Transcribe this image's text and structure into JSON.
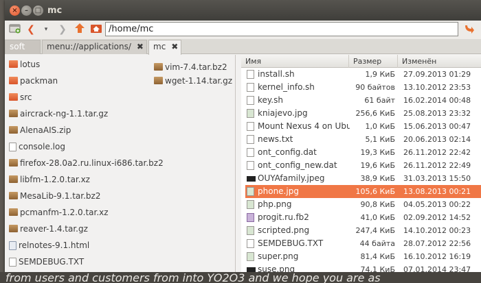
{
  "window": {
    "title": "mc"
  },
  "toolbar": {
    "path": "/home/mc"
  },
  "tabs": [
    {
      "label": "soft"
    },
    {
      "label": "menu://applications/"
    },
    {
      "label": "mc"
    }
  ],
  "left_pane": {
    "items": [
      {
        "name": "lotus",
        "kind": "folder"
      },
      {
        "name": "packman",
        "kind": "folder"
      },
      {
        "name": "src",
        "kind": "folder"
      },
      {
        "name": "aircrack-ng-1.1.tar.gz",
        "kind": "archive"
      },
      {
        "name": "AlenaAIS.zip",
        "kind": "archive"
      },
      {
        "name": "console.log",
        "kind": "text"
      },
      {
        "name": "firefox-28.0a2.ru.linux-i686.tar.bz2",
        "kind": "archive"
      },
      {
        "name": "libfm-1.2.0.tar.xz",
        "kind": "archive"
      },
      {
        "name": "MesaLib-9.1.tar.bz2",
        "kind": "archive"
      },
      {
        "name": "pcmanfm-1.2.0.tar.xz",
        "kind": "archive"
      },
      {
        "name": "reaver-1.4.tar.gz",
        "kind": "archive"
      },
      {
        "name": "relnotes-9.1.html",
        "kind": "html"
      },
      {
        "name": "SEMDEBUG.TXT",
        "kind": "text"
      },
      {
        "name": "vim-7.4.tar.bz2",
        "kind": "archive"
      },
      {
        "name": "wget-1.14.tar.gz",
        "kind": "archive"
      }
    ]
  },
  "right_pane": {
    "columns": {
      "name": "Имя",
      "size": "Размер",
      "modified": "Изменён"
    },
    "rows": [
      {
        "name": "install.sh",
        "size": "1,9 КиБ",
        "modified": "27.09.2013 01:29",
        "icon": "file"
      },
      {
        "name": "kernel_info.sh",
        "size": "90 байтов",
        "modified": "13.10.2012 23:53",
        "icon": "file"
      },
      {
        "name": "key.sh",
        "size": "61 байт",
        "modified": "16.02.2014 00:48",
        "icon": "file"
      },
      {
        "name": "kniajevo.jpg",
        "size": "256,6 КиБ",
        "modified": "25.08.2013 23:32",
        "icon": "img"
      },
      {
        "name": "Mount Nexus 4 on Ubu...",
        "size": "1,0 КиБ",
        "modified": "15.06.2013 00:47",
        "icon": "file"
      },
      {
        "name": "news.txt",
        "size": "5,1 КиБ",
        "modified": "20.06.2013 02:14",
        "icon": "file"
      },
      {
        "name": "ont_config.dat",
        "size": "19,3 КиБ",
        "modified": "26.11.2012 22:42",
        "icon": "file"
      },
      {
        "name": "ont_config_new.dat",
        "size": "19,6 КиБ",
        "modified": "26.11.2012 22:49",
        "icon": "file"
      },
      {
        "name": "OUYAfamily.jpeg",
        "size": "38,9 КиБ",
        "modified": "31.03.2013 15:50",
        "icon": "pict"
      },
      {
        "name": "phone.jpg",
        "size": "105,6 КиБ",
        "modified": "13.08.2013 00:21",
        "icon": "img",
        "selected": true
      },
      {
        "name": "php.png",
        "size": "90,8 КиБ",
        "modified": "04.05.2013 00:22",
        "icon": "img"
      },
      {
        "name": "progit.ru.fb2",
        "size": "41,0 КиБ",
        "modified": "02.09.2012 14:52",
        "icon": "book"
      },
      {
        "name": "scripted.png",
        "size": "247,4 КиБ",
        "modified": "14.10.2012 00:23",
        "icon": "img"
      },
      {
        "name": "SEMDEBUG.TXT",
        "size": "44 байта",
        "modified": "28.07.2012 22:56",
        "icon": "file"
      },
      {
        "name": "super.png",
        "size": "81,4 КиБ",
        "modified": "16.10.2012 16:19",
        "icon": "img"
      },
      {
        "name": "suse.png",
        "size": "74,1 КиБ",
        "modified": "07.01.2014 23:47",
        "icon": "pict"
      }
    ]
  },
  "background_text": "from users and customers from into YO2O3 and we hope you are as"
}
